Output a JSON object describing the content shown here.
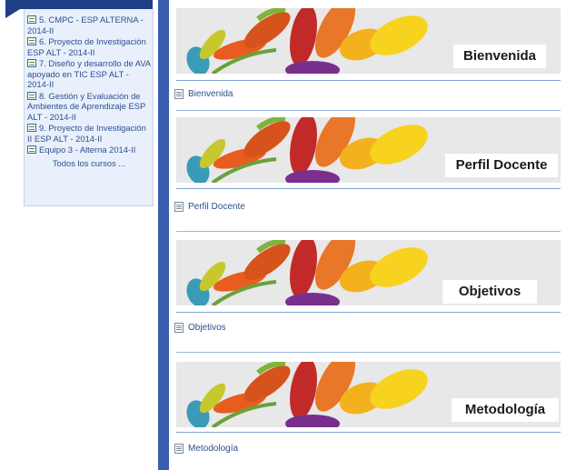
{
  "sidebar": {
    "courses": [
      "5. CMPC - ESP ALTERNA - 2014-II",
      "6. Proyecto de Investigación ESP ALT - 2014-II",
      "7. Diseño y desarrollo de AVA apoyado en TIC ESP ALT - 2014-II",
      "8. Gestión y Evaluación de Ambientes de Aprendizaje ESP ALT - 2014-II",
      "9. Proyecto de Investigación II ESP ALT - 2014-II",
      "Equipo 3 - Alterna 2014-II"
    ],
    "all_courses_link": "Todos los cursos ..."
  },
  "sections": [
    {
      "banner_label": "Bienvenida",
      "resource_link": "Bienvenida"
    },
    {
      "banner_label": "Perfil Docente",
      "resource_link": "Perfil Docente"
    },
    {
      "banner_label": "Objetivos",
      "resource_link": "Objetivos"
    },
    {
      "banner_label": "Metodología",
      "resource_link": "Metodología"
    }
  ],
  "colors": {
    "sidebar_header": "#1f3f86",
    "sidebar_bg": "#e9f0fb",
    "divider_bar": "#3b5db0",
    "link": "#2c4f8f"
  }
}
